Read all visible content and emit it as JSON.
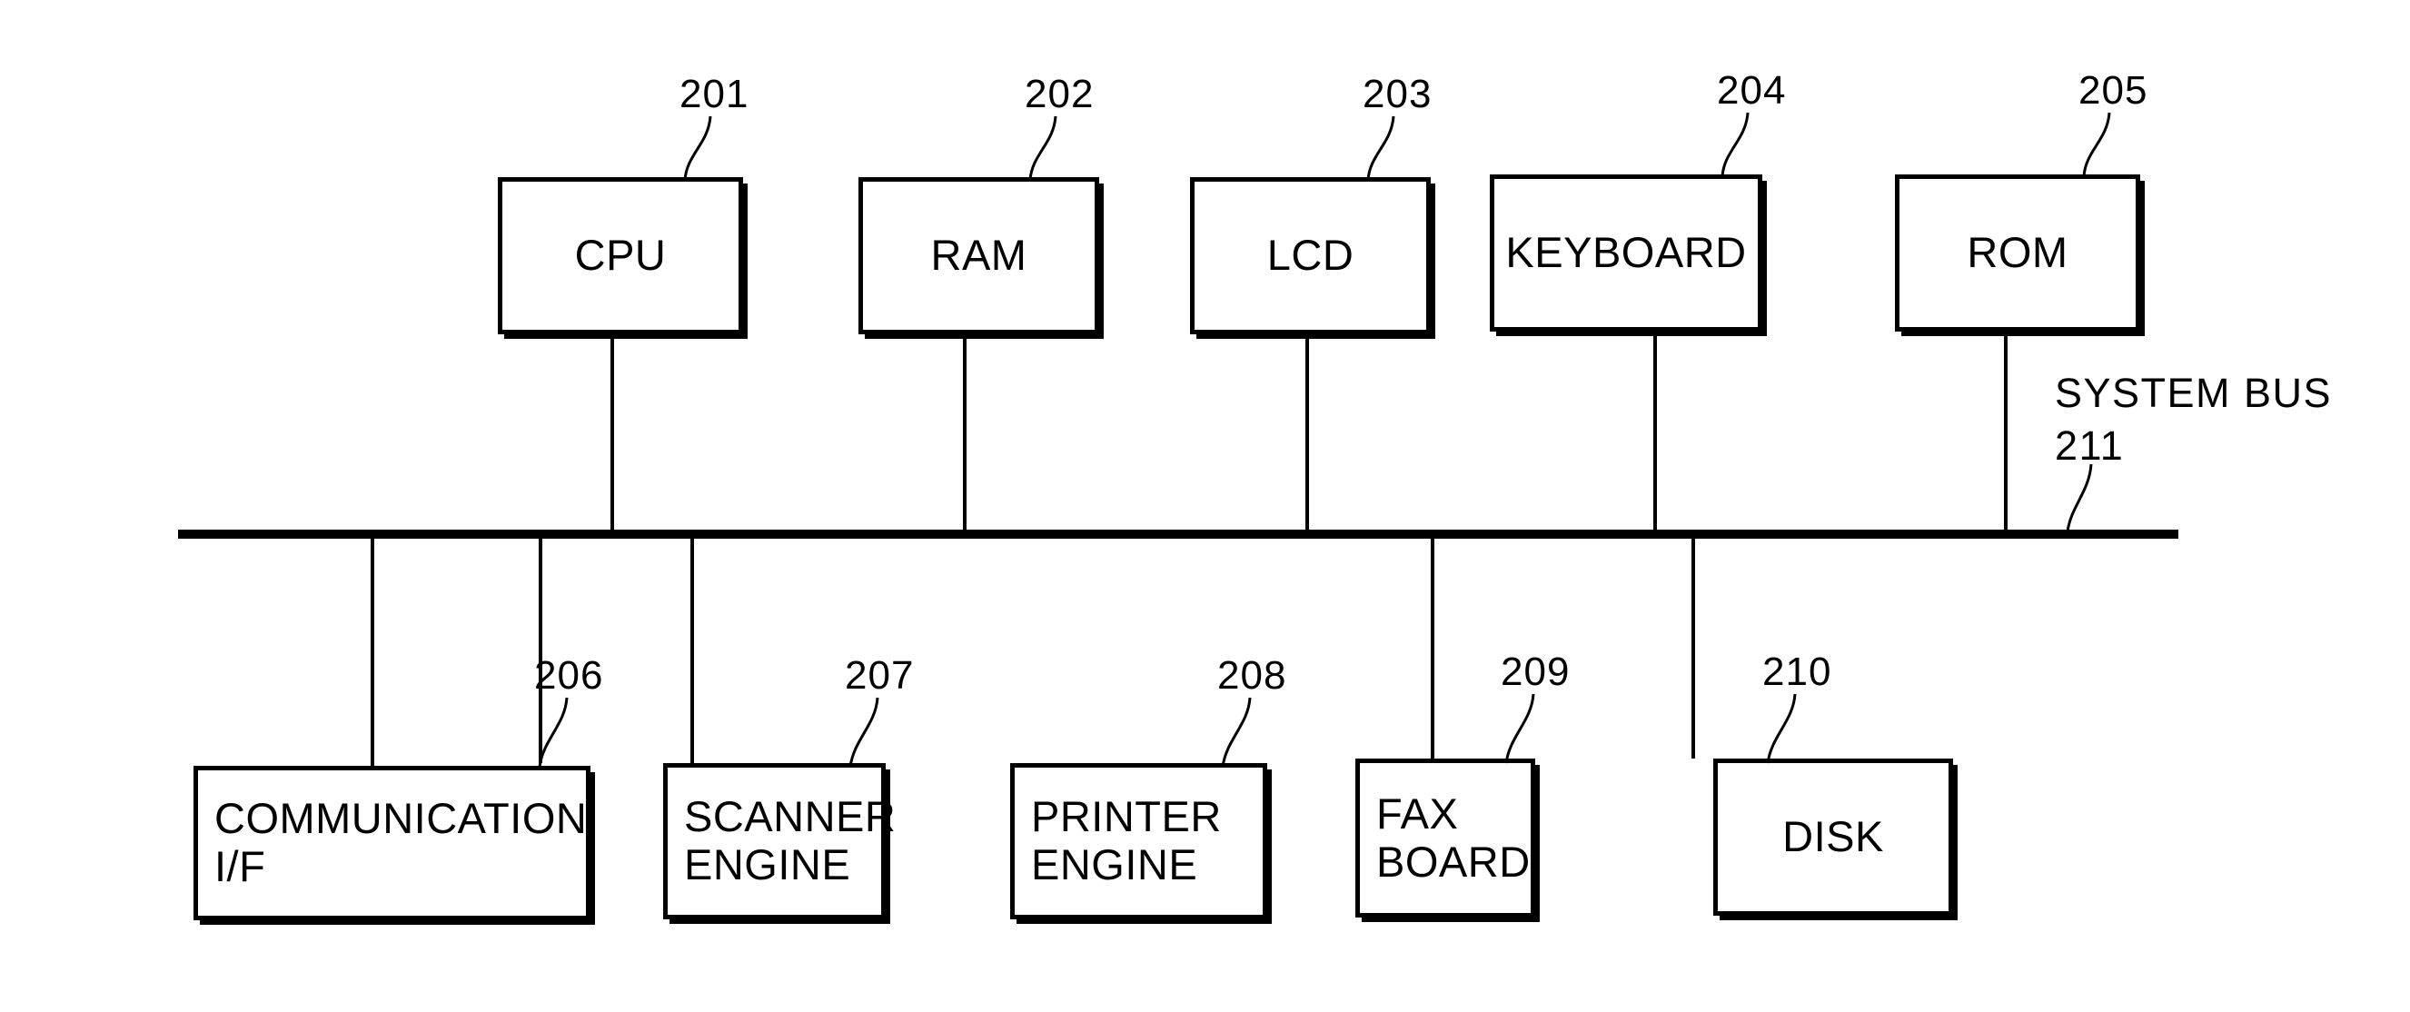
{
  "figure": {
    "bus_label_line1": "SYSTEM  BUS",
    "bus_label_line2": "211"
  },
  "top_blocks": [
    {
      "label": "CPU",
      "ref": "201"
    },
    {
      "label": "RAM",
      "ref": "202"
    },
    {
      "label": "LCD",
      "ref": "203"
    },
    {
      "label": "KEYBOARD",
      "ref": "204"
    },
    {
      "label": "ROM",
      "ref": "205"
    }
  ],
  "bottom_blocks": [
    {
      "label": "COMMUNICATION\nI/F",
      "ref": "206"
    },
    {
      "label": "SCANNER\nENGINE",
      "ref": "207"
    },
    {
      "label": "PRINTER\nENGINE",
      "ref": "208"
    },
    {
      "label": "FAX\nBOARD",
      "ref": "209"
    },
    {
      "label": "DISK",
      "ref": "210"
    }
  ],
  "colors": {
    "ink": "#000000",
    "paper": "#ffffff"
  }
}
